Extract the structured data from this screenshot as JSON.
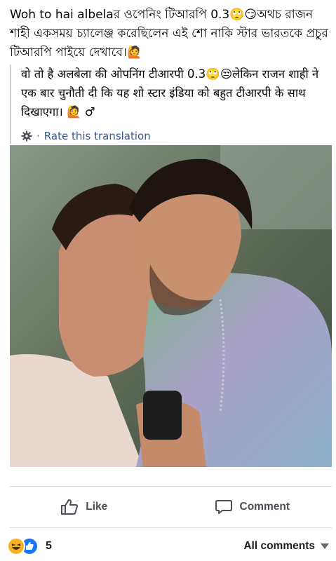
{
  "post": {
    "text": "Woh to hai albelaর ওপেনিং টিআরপি 0.3🙄😏অথচ রাজন শাহী একসময় চ্যালেঞ্জ করেছিলেন এই শো নাকি স্টার ভারতকে প্রচুর টিআরপি পাইয়ে দেখাবে।🙋"
  },
  "translation": {
    "text": "वो तो है अलबेला की ओपनिंग टीआरपी 0.3🙄😒लेकिन राजन शाही ने एक बार चुनौती दी कि यह शो स्टार इंडिया को बहुत टीआरपी के साथ दिखाएगा। 🙋 ♂",
    "dot": "·",
    "rate_label": "Rate this translation",
    "icon": "gear-icon"
  },
  "photo": {
    "description_icon": "photo"
  },
  "actions": {
    "like_label": "Like",
    "comment_label": "Comment"
  },
  "footer": {
    "reaction_icons": [
      "haha",
      "like"
    ],
    "reaction_count": "5",
    "all_comments_label": "All comments"
  },
  "colors": {
    "link": "#385898",
    "like_blue": "#1877f2",
    "haha_yellow": "#f7b125",
    "action_gray": "#4b4f56"
  }
}
